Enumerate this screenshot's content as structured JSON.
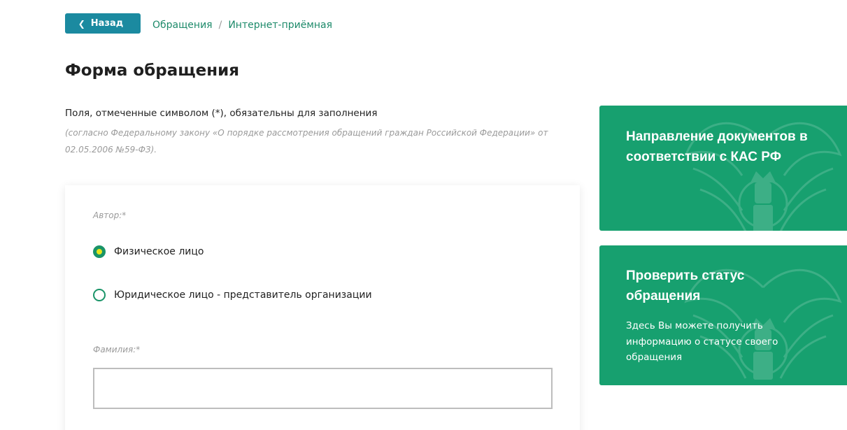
{
  "header": {
    "back_label": "Назад",
    "breadcrumb": [
      "Обращения",
      "Интернет-приёмная"
    ],
    "breadcrumb_separator": "/"
  },
  "page_title": "Форма обращения",
  "notes": {
    "required": "Поля, отмеченные символом (*), обязательны для заполнения",
    "law": "(согласно Федеральному закону «О порядке рассмотрения обращений граждан Российской Федерации» от 02.05.2006 №59-ФЗ)."
  },
  "form": {
    "author_label": "Автор:*",
    "author_options": [
      {
        "label": "Физическое лицо",
        "checked": true
      },
      {
        "label": "Юридическое лицо - представитель организации",
        "checked": false
      }
    ],
    "surname_label": "Фамилия:*",
    "surname_value": "",
    "surname_placeholder": ""
  },
  "side_cards": [
    {
      "title": "Направление документов в соответствии с КАС РФ",
      "description": ""
    },
    {
      "title": "Проверить статус обращения",
      "description": "Здесь Вы можете получить информацию о статусе своего обращения"
    }
  ],
  "colors": {
    "accent_green": "#17a06f",
    "back_button": "#1b8aa0",
    "link_green": "#1d8a6a",
    "radio_dot": "#e6e61a"
  },
  "icons": {
    "back": "chevron-left-icon",
    "card_background": "emblem-icon"
  }
}
